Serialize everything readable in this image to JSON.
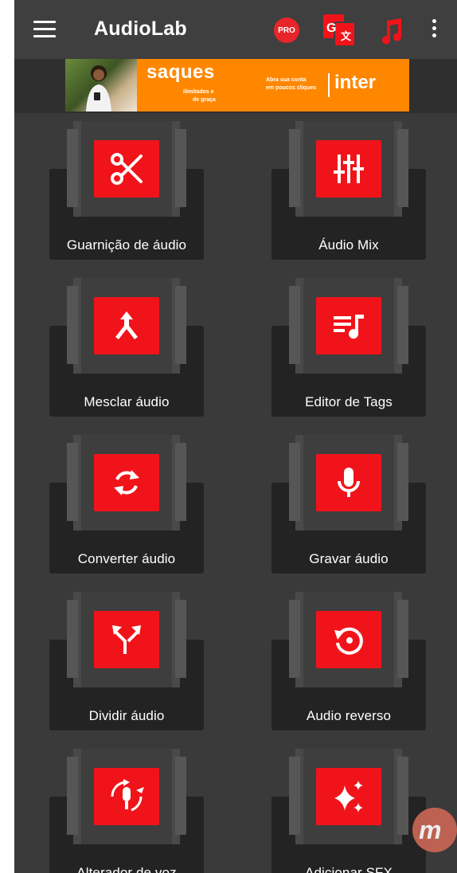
{
  "app": {
    "title": "AudioLab"
  },
  "toolbar": {
    "pro_label": "PRO",
    "icons": [
      "menu-icon",
      "pro-badge-icon",
      "translate-icon",
      "music-note-icon",
      "more-vert-icon"
    ]
  },
  "ad": {
    "headline": "saques",
    "sub_line1": "ilimitados e",
    "sub_line2": "de graça",
    "cta_line1": "Abra sua conta",
    "cta_line2": "em poucos cliques",
    "brand": "inter"
  },
  "tools": [
    {
      "label": "Guarnição de áudio",
      "icon": "scissors-icon"
    },
    {
      "label": "Áudio Mix",
      "icon": "mixer-sliders-icon"
    },
    {
      "label": "Mesclar áudio",
      "icon": "merge-arrow-icon"
    },
    {
      "label": "Editor de Tags",
      "icon": "playlist-music-icon"
    },
    {
      "label": "Converter áudio",
      "icon": "sync-arrows-icon"
    },
    {
      "label": "Gravar áudio",
      "icon": "microphone-icon"
    },
    {
      "label": "Dividir áudio",
      "icon": "split-arrows-icon"
    },
    {
      "label": "Audio reverso",
      "icon": "reverse-play-icon"
    },
    {
      "label": "Alterador de voz",
      "icon": "voice-changer-icon"
    },
    {
      "label": "Adicionar SFX",
      "icon": "sparkles-icon"
    }
  ],
  "floating_button": {
    "label": "m",
    "icon": "m-logo-icon"
  },
  "colors": {
    "accent": "#f0141a",
    "background": "#3a3a3a",
    "appbar": "#3f3f3f",
    "card": "#232323",
    "ad_orange": "#ff8700"
  }
}
